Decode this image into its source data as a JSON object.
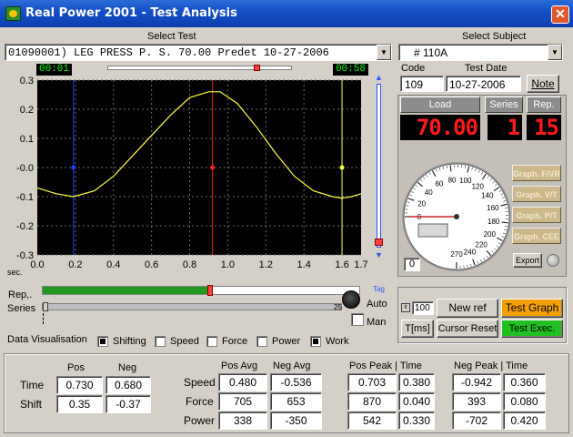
{
  "window": {
    "title": "Real Power 2001 - Test Analysis",
    "close_glyph": "✕"
  },
  "test": {
    "label": "Select Test",
    "value": "01090001) LEG PRESS P. S. 70.00 Predet 10-27-2006"
  },
  "subject": {
    "label": "Select Subject",
    "value": "# 110A",
    "code_label": "Code",
    "code": "109",
    "date_label": "Test Date",
    "date": "10-27-2006",
    "note_button": "Note"
  },
  "timer": {
    "start": "00:01",
    "end": "00:58"
  },
  "load": {
    "label": "Load",
    "value": "70.00",
    "series_label": "Series",
    "series": "1",
    "rep_label": "Rep.",
    "rep": "15"
  },
  "gauge": {
    "ticks": [
      "0",
      "20",
      "40",
      "60",
      "80",
      "100",
      "120",
      "140",
      "160",
      "180",
      "200",
      "220",
      "240",
      "270"
    ],
    "counter": "0",
    "needle_value": 0
  },
  "graph_buttons": [
    "Graph. F/VR",
    "Graph. V/T",
    "Graph. P/T",
    "Graph. CEE"
  ],
  "export_button": "Export",
  "chart_data": {
    "type": "line",
    "xlabel": "sec.",
    "x_ticks": [
      "0.0",
      "0.2",
      "0.4",
      "0.6",
      "0.8",
      "1.0",
      "1.2",
      "1.4",
      "1.6",
      "1.7"
    ],
    "y_ticks": [
      "0.3",
      "0.2",
      "0.1",
      "-0.0",
      "-0.1",
      "-0.2",
      "-0.3"
    ],
    "xlim": [
      0.0,
      1.7
    ],
    "ylim": [
      -0.3,
      0.3
    ],
    "series": [
      {
        "color": "#ffff40",
        "x": [
          0.0,
          0.1,
          0.19,
          0.3,
          0.4,
          0.5,
          0.6,
          0.7,
          0.8,
          0.9,
          0.96,
          1.05,
          1.15,
          1.25,
          1.35,
          1.45,
          1.55,
          1.6,
          1.65,
          1.7
        ],
        "y": [
          -0.07,
          -0.09,
          -0.1,
          -0.08,
          -0.03,
          0.04,
          0.11,
          0.18,
          0.24,
          0.26,
          0.26,
          0.22,
          0.14,
          0.05,
          -0.03,
          -0.08,
          -0.1,
          -0.105,
          -0.1,
          -0.09
        ]
      }
    ],
    "cursors": [
      {
        "x": 0.19,
        "y": 0.0,
        "color": "#2040ff"
      },
      {
        "x": 0.92,
        "y": 0.0,
        "color": "#ff2020"
      },
      {
        "x": 1.6,
        "y": 0.0,
        "color": "#ffff40"
      }
    ],
    "grid": true
  },
  "rep_series": {
    "rep_label": "Rep,.",
    "series_label": "Series",
    "tag_label": "Tag",
    "end_tick": "25",
    "rep_progress": 0.53
  },
  "mode": {
    "auto_label": "Auto",
    "man_label": "Man"
  },
  "visualisation": {
    "label": "Data Visualisation",
    "options": [
      {
        "label": "Shifting",
        "checked": true
      },
      {
        "label": "Speed",
        "checked": false
      },
      {
        "label": "Force",
        "checked": false
      },
      {
        "label": "Power",
        "checked": false
      },
      {
        "label": "Work",
        "checked": true
      }
    ]
  },
  "controls": {
    "count": "100",
    "new_ref": "New ref",
    "test_graph": "Test Graph",
    "tms": "T[ms]",
    "cursor_reset": "Cursor Reset",
    "test_exec": "Test Exec."
  },
  "stats": {
    "pos_label": "Pos",
    "neg_label": "Neg",
    "time_label": "Time",
    "time_pos": "0.730",
    "time_neg": "0.680",
    "shift_label": "Shift",
    "shift_pos": "0.35",
    "shift_neg": "-0.37",
    "pos_avg_label": "Pos Avg",
    "neg_avg_label": "Neg Avg",
    "pos_peak_label": "Pos Peak | Time",
    "neg_peak_label": "Neg Peak | Time",
    "rows": [
      {
        "label": "Speed",
        "pos_avg": "0.480",
        "neg_avg": "-0.536",
        "pos_peak": "0.703",
        "pos_time": "0.380",
        "neg_peak": "-0.942",
        "neg_time": "0.360"
      },
      {
        "label": "Force",
        "pos_avg": "705",
        "neg_avg": "653",
        "pos_peak": "870",
        "pos_time": "0.040",
        "neg_peak": "393",
        "neg_time": "0.080"
      },
      {
        "label": "Power",
        "pos_avg": "338",
        "neg_avg": "-350",
        "pos_peak": "542",
        "pos_time": "0.330",
        "neg_peak": "-702",
        "neg_time": "0.420"
      }
    ]
  }
}
